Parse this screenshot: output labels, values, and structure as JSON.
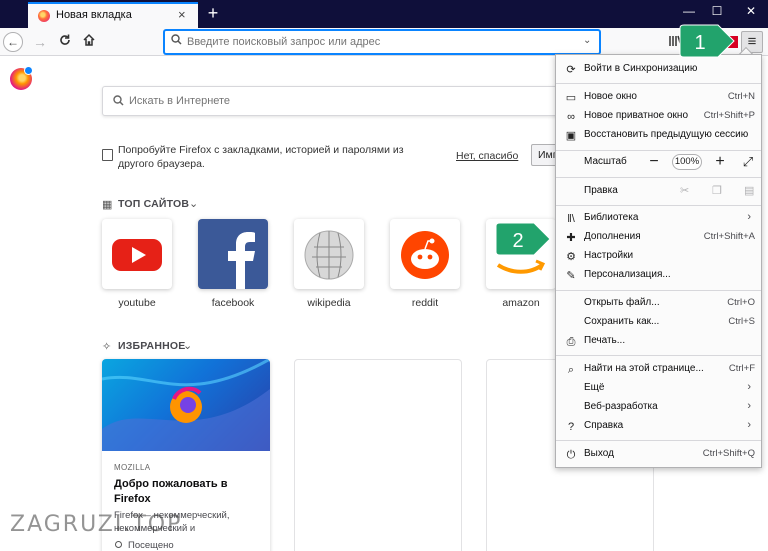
{
  "browser": {
    "tab_title": "Новая вкладка",
    "tab_close": "×",
    "new_tab": "+",
    "window_controls": {
      "minimize": "—",
      "maximize": "☐",
      "close": "✕"
    },
    "url_placeholder": "Введите поисковый запрос или адрес",
    "menu_button_icon": "≡"
  },
  "newtab": {
    "search_placeholder": "Искать в Интернете",
    "sync_promo": "Попробуйте Firefox с закладками, историей и паролями из другого браузера.",
    "sync_dismiss": "Нет, спасибо",
    "sync_button": "Импорт",
    "top_sites_heading": "ТОП САЙТОВ",
    "top_sites": [
      {
        "label": "youtube",
        "icon": "youtube-icon",
        "color": "#ffffff"
      },
      {
        "label": "facebook",
        "icon": "facebook-icon",
        "color": "#3b5998"
      },
      {
        "label": "wikipedia",
        "icon": "wikipedia-icon",
        "color": "#ffffff"
      },
      {
        "label": "reddit",
        "icon": "reddit-icon",
        "color": "#ffffff"
      },
      {
        "label": "amazon",
        "icon": "amazon-icon",
        "color": "#ffffff"
      }
    ],
    "highlights_heading": "ИЗБРАННОЕ",
    "card": {
      "source": "MOZILLA",
      "title": "Добро пожаловать в Firefox",
      "description": "Firefox – некоммерческий, некоммерческий и",
      "visited": "Посещено"
    }
  },
  "menu": {
    "sync": "Войти в Синхронизацию",
    "new_window": {
      "label": "Новое окно",
      "shortcut": "Ctrl+N"
    },
    "private_window": {
      "label": "Новое приватное окно",
      "shortcut": "Ctrl+Shift+P"
    },
    "restore_session": "Восстановить предыдущую сессию",
    "zoom_label": "Масштаб",
    "zoom_minus": "−",
    "zoom_value": "100%",
    "zoom_plus": "+",
    "edit_label": "Правка",
    "library": "Библиотека",
    "addons": {
      "label": "Дополнения",
      "shortcut": "Ctrl+Shift+A"
    },
    "settings": "Настройки",
    "customize": "Персонализация...",
    "open_file": {
      "label": "Открыть файл...",
      "shortcut": "Ctrl+O"
    },
    "save_as": {
      "label": "Сохранить как...",
      "shortcut": "Ctrl+S"
    },
    "print": "Печать...",
    "find": {
      "label": "Найти на этой странице...",
      "shortcut": "Ctrl+F"
    },
    "more": "Ещё",
    "web_dev": "Веб-разработка",
    "help": "Справка",
    "exit": {
      "label": "Выход",
      "shortcut": "Ctrl+Shift+Q"
    }
  },
  "markers": {
    "first": "1",
    "second": "2",
    "color": "#22a36c"
  },
  "watermark": "ZAGRUZI.TOP"
}
